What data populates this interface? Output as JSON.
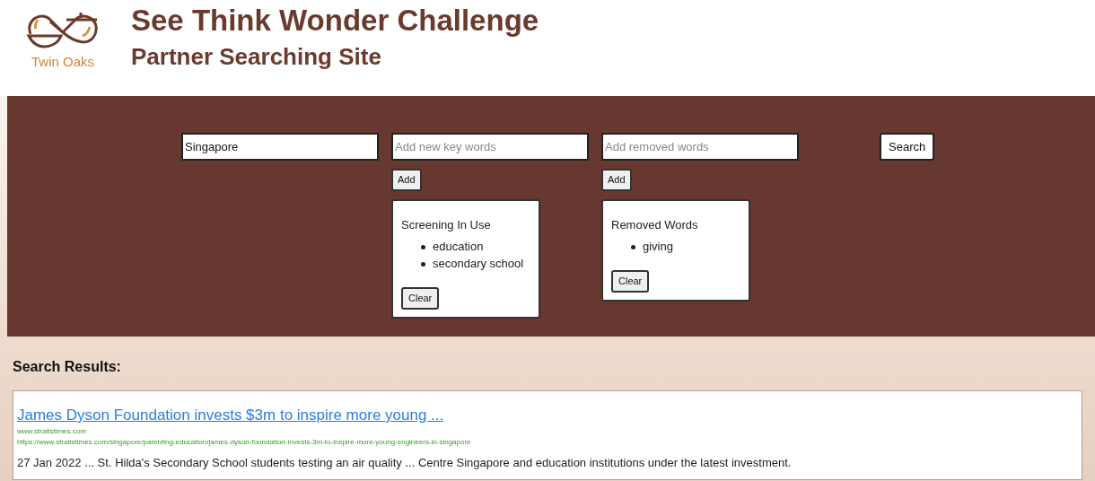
{
  "header": {
    "logo_text": "Twin Oaks",
    "title": "See Think Wonder Challenge",
    "subtitle": "Partner Searching Site"
  },
  "search_panel": {
    "query": {
      "value": "Singapore"
    },
    "keywords": {
      "placeholder": "Add new key words",
      "add_button": "Add",
      "box_title": "Screening In Use",
      "items": [
        "education",
        "secondary school"
      ],
      "clear_button": "Clear"
    },
    "removed": {
      "placeholder": "Add removed words",
      "add_button": "Add",
      "box_title": "Removed Words",
      "items": [
        "giving"
      ],
      "clear_button": "Clear"
    },
    "search_button": "Search"
  },
  "results": {
    "heading": "Search Results:",
    "items": [
      {
        "title": "James Dyson Foundation invests $3m to inspire more young ...",
        "site": "www.straitstimes.com",
        "url": "https://www.straitstimes.com/singapore/parenting-education/james-dyson-foundation-invests-3m-to-inspire-more-young-engineers-in-singapore",
        "snippet": "27 Jan 2022 ... St. Hilda's Secondary School students testing an air quality ... Centre Singapore and education institutions under the latest investment."
      }
    ]
  }
}
